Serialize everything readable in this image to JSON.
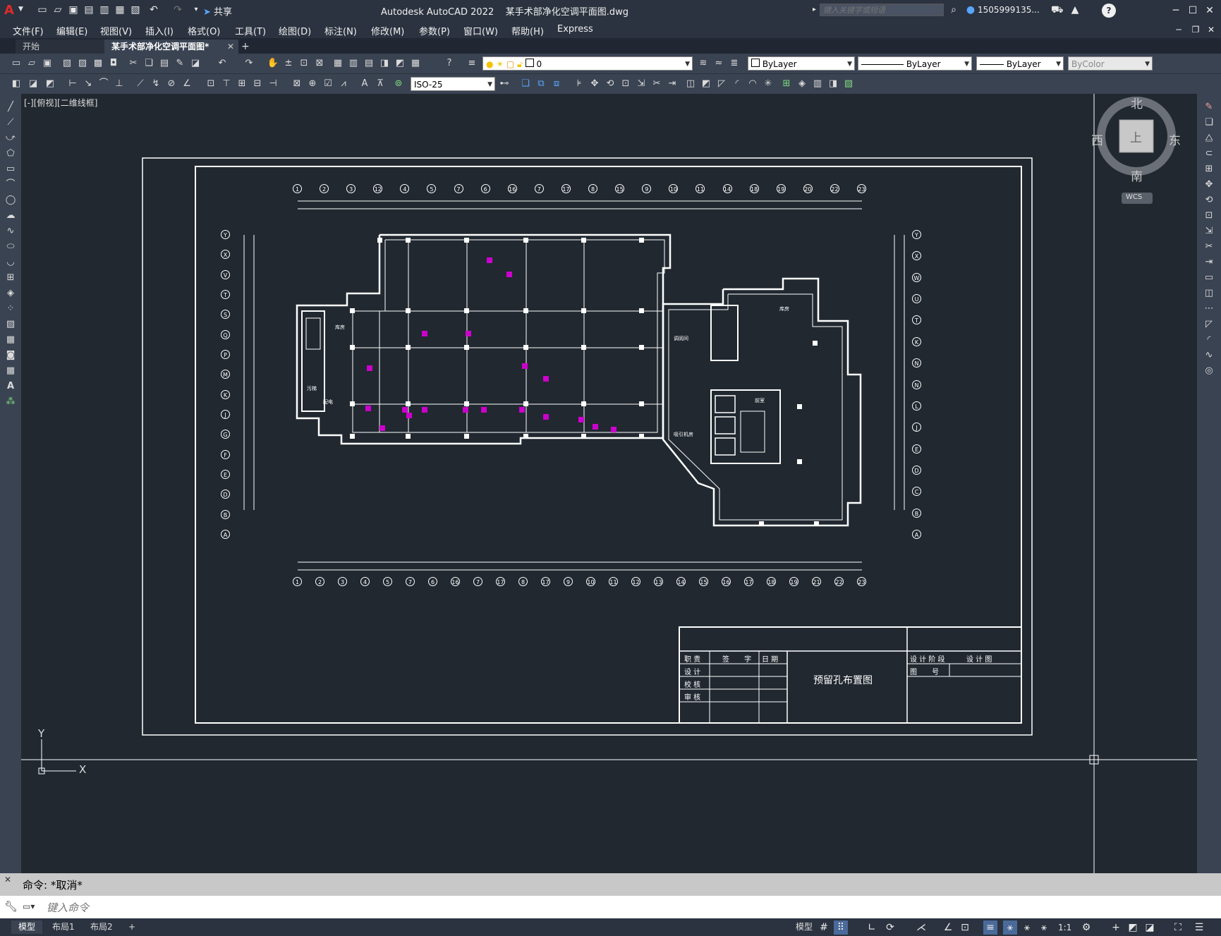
{
  "title_bar": {
    "app_title": "Autodesk AutoCAD 2022",
    "file_name": "某手术部净化空调平面图.dwg",
    "share_label": "共享",
    "search_placeholder": "键入关键字或短语",
    "user_name": "1505999135...",
    "help_label": "?"
  },
  "menu": [
    "文件(F)",
    "编辑(E)",
    "视图(V)",
    "插入(I)",
    "格式(O)",
    "工具(T)",
    "绘图(D)",
    "标注(N)",
    "修改(M)",
    "参数(P)",
    "窗口(W)",
    "帮助(H)",
    "Express"
  ],
  "doc_tabs": {
    "start": "开始",
    "active": "某手术部净化空调平面图*",
    "add": "+"
  },
  "toolbar": {
    "layer_value": "0",
    "color_value": "ByLayer",
    "linetype_value": "ByLayer",
    "lineweight_value": "ByLayer",
    "plotstyle_value": "ByColor",
    "dimstyle_value": "ISO-25"
  },
  "viewport": {
    "label": "[-][俯视][二维线框]",
    "compass": {
      "north": "北",
      "south": "南",
      "east": "东",
      "west": "西",
      "top": "上"
    },
    "wcs_label": "WCS",
    "ucs_x": "X",
    "ucs_y": "Y"
  },
  "drawing": {
    "grid_top": [
      "1",
      "2",
      "3",
      "12",
      "4",
      "5",
      "7",
      "6",
      "16",
      "7",
      "17",
      "8",
      "15",
      "9",
      "10",
      "11",
      "14",
      "18",
      "19",
      "20",
      "22",
      "23"
    ],
    "grid_bottom": [
      "1",
      "2",
      "3",
      "4",
      "5",
      "7",
      "6",
      "16",
      "7",
      "17",
      "8",
      "17",
      "9",
      "10",
      "11",
      "12",
      "13",
      "14",
      "15",
      "16",
      "17",
      "18",
      "19",
      "21",
      "22",
      "23"
    ],
    "grid_left": [
      "Y",
      "X",
      "V",
      "T",
      "S",
      "Q",
      "P",
      "M",
      "K",
      "J",
      "G",
      "F",
      "E",
      "D",
      "B",
      "A"
    ],
    "grid_right": [
      "Y",
      "X",
      "W",
      "U",
      "T",
      "K",
      "N",
      "N",
      "L",
      "J",
      "E",
      "D",
      "C",
      "B",
      "A"
    ],
    "room_labels": [
      "库房",
      "库房",
      "调阅间",
      "前室",
      "配电",
      "污梯",
      "吸引机房"
    ],
    "title_block": {
      "drawing_title": "预留孔布置图",
      "rows": [
        [
          "职 责",
          "签 字",
          "日 期"
        ],
        [
          "设 计",
          "",
          ""
        ],
        [
          "校 核",
          "",
          ""
        ],
        [
          "审 核",
          "",
          ""
        ]
      ],
      "stage_label": "设 计 阶 段",
      "stage_value": "设 计 图",
      "number_label": "图 号"
    }
  },
  "command": {
    "history": "命令: *取消*",
    "input_placeholder": "键入命令"
  },
  "status_bar": {
    "tabs": [
      "模型",
      "布局1",
      "布局2"
    ],
    "model_label": "模型",
    "scale": "1:1"
  },
  "colors": {
    "bg": "#212830",
    "panel": "#3a4352",
    "drawing_line": "#ffffff",
    "accent_magenta": "#cc00cc",
    "logo_red": "#e02a2a"
  }
}
